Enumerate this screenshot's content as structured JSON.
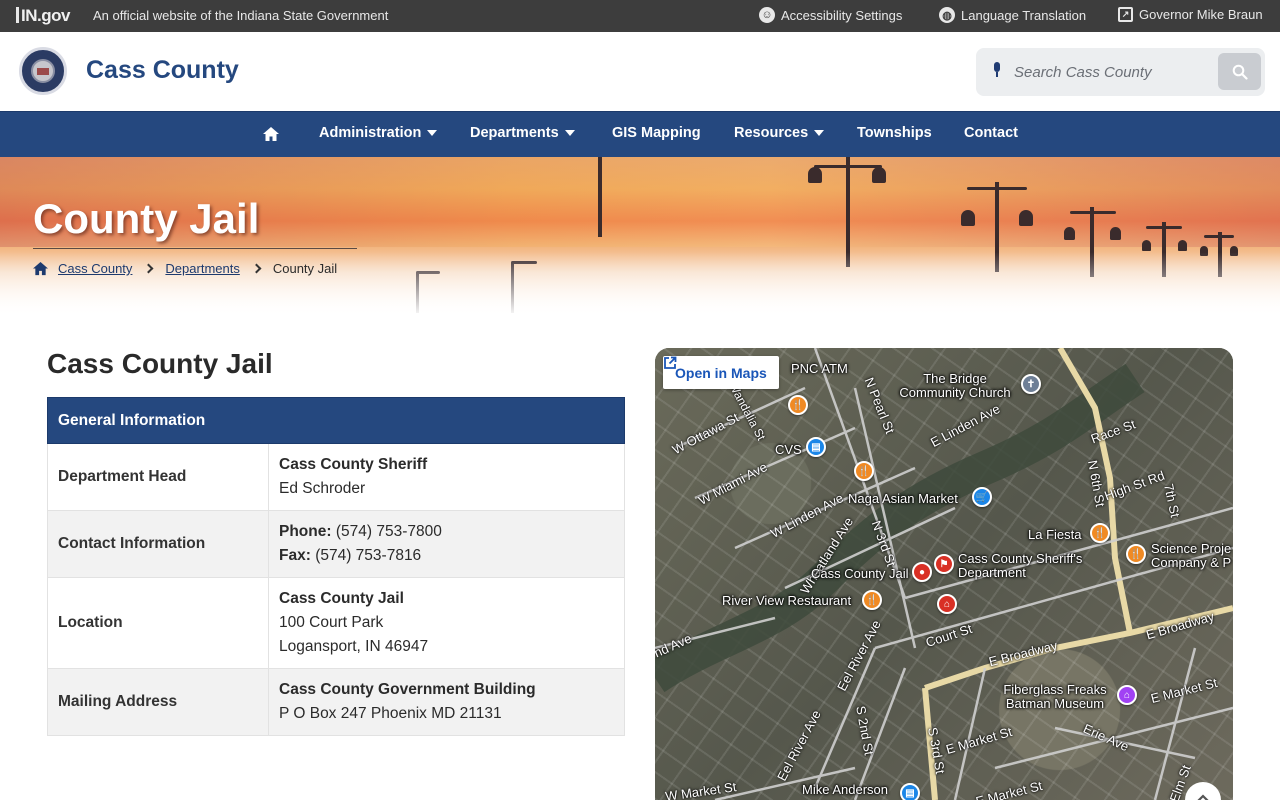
{
  "statebar": {
    "brand": "IN.gov",
    "official_text": "An official website of the Indiana State Government",
    "accessibility": "Accessibility Settings",
    "language": "Language Translation",
    "governor": "Governor Mike Braun"
  },
  "header": {
    "site_title": "Cass County",
    "search_placeholder": "Search Cass County"
  },
  "nav": {
    "items": [
      {
        "label": "Administration",
        "dropdown": true
      },
      {
        "label": "Departments",
        "dropdown": true
      },
      {
        "label": "GIS Mapping",
        "dropdown": false
      },
      {
        "label": "Resources",
        "dropdown": true
      },
      {
        "label": "Townships",
        "dropdown": false
      },
      {
        "label": "Contact",
        "dropdown": false
      }
    ]
  },
  "hero": {
    "title": "County Jail",
    "breadcrumb": [
      "Cass County",
      "Departments",
      "County Jail"
    ]
  },
  "main": {
    "heading": "Cass County Jail",
    "table": {
      "header": "General Information",
      "rows": [
        {
          "label": "Department Head",
          "line1": "Cass County Sheriff",
          "line2": "Ed Schroder"
        },
        {
          "label": "Contact Information",
          "phone_label": "Phone:",
          "phone": "(574) 753-7800",
          "fax_label": "Fax:",
          "fax": "(574) 753-7816"
        },
        {
          "label": "Location",
          "line1": "Cass County Jail",
          "line2": "100 Court Park",
          "line3": "Logansport, IN 46947"
        },
        {
          "label": "Mailing Address",
          "line1": "Cass County Government Building",
          "line2": "P O Box 247 Phoenix MD 21131"
        }
      ]
    }
  },
  "map": {
    "open_in_maps": "Open in Maps",
    "streets": [
      "W Ottawa St",
      "Wandalia St",
      "W Miami Ave",
      "W Linden Ave",
      "Wheatland Ave",
      "N 3rd St",
      "N Pearl St",
      "E Linden Ave",
      "Race St",
      "N 6th St",
      "High St Rd",
      "7th St",
      "E Broadway",
      "E Broadway",
      "Court St",
      "Eel River Ave",
      "Eel River Ave",
      "S 2nd St",
      "S 3rd St",
      "E Market St",
      "E Market St",
      "Erie Ave",
      "nd Ave",
      "W Market St",
      "Elm St",
      "E Market St"
    ],
    "pois": [
      "PNC ATM",
      "The Bridge Community Church",
      "CVS",
      "Naga Asian Market",
      "La Fiesta",
      "Science Proje Company & P",
      "Cass County Sheriff's Department",
      "Cass County Jail",
      "River View Restaurant",
      "Fiberglass Freaks Batman Museum",
      "Mike Anderson"
    ]
  }
}
